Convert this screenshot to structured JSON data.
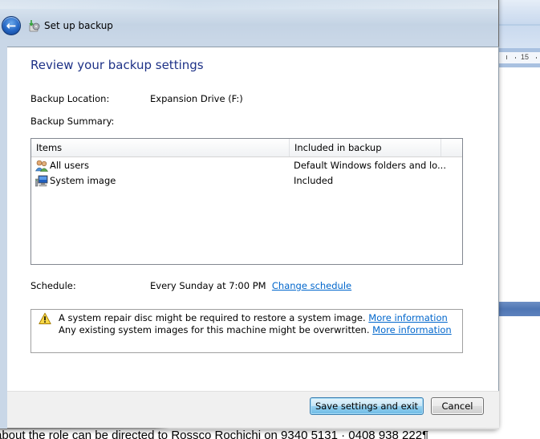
{
  "window": {
    "title": "Set up backup",
    "back_button_icon": "back-arrow-icon",
    "app_icon": "backup-icon"
  },
  "page": {
    "heading": "Review your backup settings",
    "backup_location_label": "Backup Location:",
    "backup_location_value": "Expansion Drive (F:)",
    "backup_summary_label": "Backup Summary:"
  },
  "summary_table": {
    "columns": [
      "Items",
      "Included in backup"
    ],
    "rows": [
      {
        "icon": "users-icon",
        "item": "All users",
        "included": "Default Windows folders and lo..."
      },
      {
        "icon": "computer-icon",
        "item": "System image",
        "included": "Included"
      }
    ]
  },
  "schedule": {
    "label": "Schedule:",
    "value": "Every Sunday at 7:00 PM",
    "change_link": "Change schedule"
  },
  "warnings": {
    "icon": "warning-icon",
    "lines": [
      {
        "text": "A system repair disc might be required to restore a system image.",
        "link": "More information"
      },
      {
        "text": "Any existing system images for this machine might be overwritten.",
        "link": "More information"
      }
    ]
  },
  "footer": {
    "save_label": "Save settings and exit",
    "cancel_label": "Cancel"
  },
  "background": {
    "ruler_number": "15",
    "document_text": "about the role can be directed to Rossco Rochichi on 9340 5131 · 0408 938 222¶"
  },
  "colors": {
    "heading": "#1e3287",
    "link": "#0066cc",
    "primary_button": "#98d1ef"
  }
}
